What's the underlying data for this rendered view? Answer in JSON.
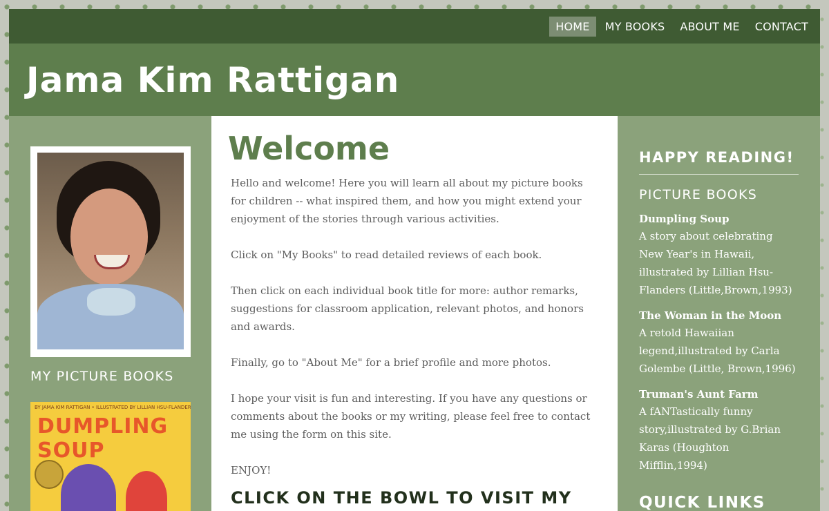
{
  "nav": {
    "items": [
      {
        "label": "HOME",
        "active": true
      },
      {
        "label": "MY BOOKS",
        "active": false
      },
      {
        "label": "ABOUT ME",
        "active": false
      },
      {
        "label": "CONTACT",
        "active": false
      }
    ]
  },
  "header": {
    "title": "Jama Kim Rattigan"
  },
  "left": {
    "heading": "MY PICTURE BOOKS",
    "cover": {
      "byline": "BY JAMA KIM RATTIGAN • ILLUSTRATED BY LILLIAN HSU-FLANDERS",
      "title": "DUMPLING SOUP"
    }
  },
  "main": {
    "title": "Welcome",
    "paragraphs": [
      "Hello and welcome! Here you will learn all about my picture books for children -- what inspired them, and how you might extend your enjoyment of the stories through various activities.",
      "Click on \"My Books\" to read detailed reviews of each book.",
      "Then click on each individual book title for more: author remarks, suggestions for classroom application, relevant photos, and honors and awards.",
      "Finally, go to \"About Me\" for a brief profile and more photos.",
      "I hope your visit is fun and interesting. If you have any questions or comments about the books or my writing, please feel free to contact me using the form on this site.",
      "ENJOY!"
    ],
    "cta": "CLICK ON THE BOWL TO VISIT MY"
  },
  "right": {
    "heading": "HAPPY READING!",
    "subheading": "PICTURE BOOKS",
    "books": [
      {
        "title": "Dumpling Soup",
        "desc": "A story about celebrating New Year's in Hawaii, illustrated by Lillian Hsu-Flanders (Little,Brown,1993)"
      },
      {
        "title": "The Woman in the Moon",
        "desc": "A retold Hawaiian legend,illustrated by Carla Golembe (Little, Brown,1996)"
      },
      {
        "title": "Truman's Aunt Farm",
        "desc": "A fANTastically funny story,illustrated by G.Brian Karas (Houghton Mifflin,1994)"
      }
    ],
    "quick_links": "QUICK LINKS"
  },
  "colors": {
    "nav_bg": "#3f5b33",
    "header_bg": "#5e7e4d",
    "sidebar_bg": "#8ba27b",
    "accent_green": "#5e7e4d"
  }
}
